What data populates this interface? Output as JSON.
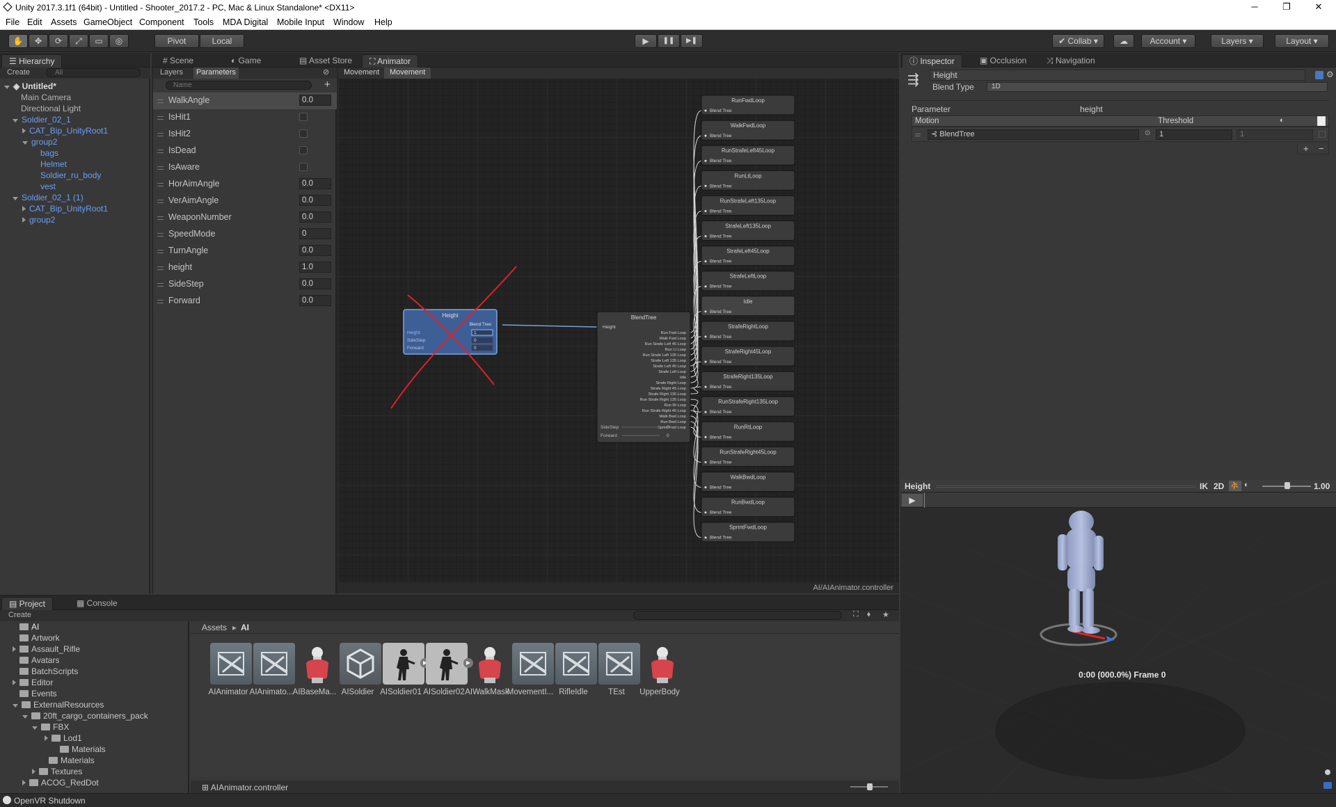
{
  "window": {
    "title": "Unity 2017.3.1f1 (64bit) - Untitled - Shooter_2017.2 - PC, Mac & Linux Standalone* <DX11>",
    "minimize": "─",
    "maximize": "❐",
    "close": "✕"
  },
  "menu": [
    "File",
    "Edit",
    "Assets",
    "GameObject",
    "Component",
    "Tools",
    "MDA Digital",
    "Mobile Input",
    "Window",
    "Help"
  ],
  "toolbar": {
    "pivot": "Pivot",
    "local": "Local",
    "play": "▶",
    "pause": "❚❚",
    "step": "▶❚",
    "collab": "Collab",
    "account": "Account",
    "layers": "Layers",
    "layout": "Layout"
  },
  "hierarchy": {
    "tab": "Hierarchy",
    "create": "Create",
    "search_placeholder": "All",
    "scene": "Untitled*",
    "items": [
      {
        "label": "Main Camera",
        "blue": false
      },
      {
        "label": "Directional Light",
        "blue": false
      },
      {
        "label": "Soldier_02_1",
        "blue": true
      },
      {
        "label": "CAT_Bip_UnityRoot1",
        "blue": true
      },
      {
        "label": "group2",
        "blue": true
      },
      {
        "label": "bags",
        "blue": true
      },
      {
        "label": "Helmet",
        "blue": true
      },
      {
        "label": "Soldier_ru_body",
        "blue": true
      },
      {
        "label": "vest",
        "blue": true
      },
      {
        "label": "Soldier_02_1 (1)",
        "blue": true
      },
      {
        "label": "CAT_Bip_UnityRoot1",
        "blue": true
      },
      {
        "label": "group2",
        "blue": true
      }
    ]
  },
  "animator": {
    "tabs": {
      "scene": "Scene",
      "game": "Game",
      "asset_store": "Asset Store",
      "animator": "Animator"
    },
    "subtabs": {
      "layers": "Layers",
      "parameters": "Parameters"
    },
    "name_placeholder": "Name",
    "breadcrumb": [
      "Movement",
      "Movement"
    ],
    "params": [
      {
        "name": "WalkAngle",
        "type": "float",
        "value": "0.0"
      },
      {
        "name": "IsHit1",
        "type": "bool"
      },
      {
        "name": "IsHit2",
        "type": "bool"
      },
      {
        "name": "IsDead",
        "type": "bool"
      },
      {
        "name": "IsAware",
        "type": "bool"
      },
      {
        "name": "HorAimAngle",
        "type": "float",
        "value": "0.0"
      },
      {
        "name": "VerAimAngle",
        "type": "float",
        "value": "0.0"
      },
      {
        "name": "WeaponNumber",
        "type": "float",
        "value": "0.0"
      },
      {
        "name": "SpeedMode",
        "type": "int",
        "value": "0"
      },
      {
        "name": "TurnAngle",
        "type": "float",
        "value": "0.0"
      },
      {
        "name": "height",
        "type": "float",
        "value": "1.0"
      },
      {
        "name": "SideStep",
        "type": "float",
        "value": "0.0"
      },
      {
        "name": "Forward",
        "type": "float",
        "value": "0.0"
      }
    ],
    "height_node": {
      "title": "Height",
      "subtitle": "Blend Tree",
      "rows": [
        {
          "label": "Height",
          "value": "1"
        },
        {
          "label": "SideStep",
          "value": "0"
        },
        {
          "label": "Forward",
          "value": "0"
        }
      ]
    },
    "blendtree_node": {
      "title": "BlendTree",
      "input": "Height",
      "outputs": [
        "Run Fwd Loop",
        "Walk Fwd Loop",
        "Run Strafe Left 45 Loop",
        "Run Lt Loop",
        "Run Strafe Left 135 Loop",
        "Strafe Left 135 Loop",
        "Strafe Left 45 Loop",
        "Strafe Left Loop",
        "Idle",
        "Strafe Right Loop",
        "Strafe Right 45 Loop",
        "Strafe Right 135 Loop",
        "Run Strafe Right 135 Loop",
        "Run Rt Loop",
        "Run Strafe Right 45 Loop",
        "Walk Bwd Loop",
        "Run Bwd Loop",
        "Sprint Fwd Loop"
      ],
      "params": [
        {
          "label": "SideStep",
          "value": "0"
        },
        {
          "label": "Forward",
          "value": "0"
        }
      ]
    },
    "leaf_nodes": [
      "RunFwdLoop",
      "WalkFwdLoop",
      "RunStrafeLeft45Loop",
      "RunLtLoop",
      "RunStrafeLeft135Loop",
      "StrafeLeft135Loop",
      "StrafeLeft45Loop",
      "StrafeLeftLoop",
      "Idle",
      "StrafeRightLoop",
      "StrafeRight45Loop",
      "StrafeRight135Loop",
      "RunStrafeRight135Loop",
      "RunRtLoop",
      "RunStrafeRight45Loop",
      "WalkBwdLoop",
      "RunBwdLoop",
      "SprintFwdLoop"
    ],
    "leaf_subtitle": "Blend Tree",
    "status_path": "AI/AIAnimator.controller"
  },
  "inspector": {
    "tabs": {
      "inspector": "Inspector",
      "occlusion": "Occlusion",
      "navigation": "Navigation"
    },
    "name": "Height",
    "blend_type_label": "Blend Type",
    "blend_type": "1D",
    "parameter_label": "Parameter",
    "parameter": "height",
    "motion_header": "Motion",
    "threshold_header": "Threshold",
    "motion_row": {
      "motion": "BlendTree",
      "threshold": "1",
      "extra": "1"
    },
    "add": "+",
    "remove": "−"
  },
  "preview": {
    "title": "Height",
    "ik": "IK",
    "twod": "2D",
    "speed": "1.00",
    "time": "0:00 (000.0%) Frame 0"
  },
  "project": {
    "tabs": {
      "project": "Project",
      "console": "Console"
    },
    "create": "Create",
    "tree": [
      "AI",
      "Artwork",
      "Assault_Rifle",
      "Avatars",
      "BatchScripts",
      "Editor",
      "Events",
      "ExternalResources",
      "20ft_cargo_containers_pack",
      "FBX",
      "Lod1",
      "Materials",
      "Materials",
      "Textures",
      "ACOG_RedDot"
    ],
    "breadcrumb": [
      "Assets",
      "AI"
    ],
    "assets": [
      {
        "name": "AIAnimator",
        "kind": "controller"
      },
      {
        "name": "AIAnimato...",
        "kind": "controller"
      },
      {
        "name": "AIBaseMa...",
        "kind": "mask"
      },
      {
        "name": "AISoldier",
        "kind": "unity"
      },
      {
        "name": "AISoldier01",
        "kind": "clip"
      },
      {
        "name": "AISoldier02",
        "kind": "clip"
      },
      {
        "name": "AIWalkMask",
        "kind": "mask"
      },
      {
        "name": "MovementI...",
        "kind": "controller"
      },
      {
        "name": "RifleIdle",
        "kind": "controller"
      },
      {
        "name": "TEst",
        "kind": "controller"
      },
      {
        "name": "UpperBody",
        "kind": "mask"
      }
    ],
    "selected_file": "AIAnimator.controller"
  },
  "statusbar": {
    "message": "OpenVR Shutdown"
  },
  "colors": {
    "accent_blue": "#6d9ef1",
    "cross": "#e0212a",
    "selection": "#3e5f96"
  }
}
